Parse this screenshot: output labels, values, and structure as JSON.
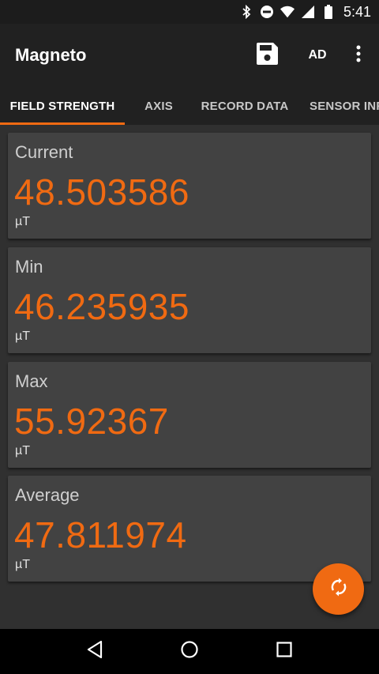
{
  "status_bar": {
    "time": "5:41",
    "icons": [
      "bluetooth-icon",
      "do-not-disturb-icon",
      "wifi-icon",
      "cell-signal-icon",
      "battery-icon"
    ]
  },
  "app_bar": {
    "title": "Magneto",
    "ad_label": "AD",
    "save_icon": "save-icon",
    "more_icon": "more-vert-icon"
  },
  "tabs": [
    {
      "label": "FIELD STRENGTH",
      "active": true
    },
    {
      "label": "AXIS",
      "active": false
    },
    {
      "label": "RECORD DATA",
      "active": false
    },
    {
      "label": "SENSOR INFO",
      "active": false
    }
  ],
  "cards": [
    {
      "label": "Current",
      "value": "48.503586",
      "unit": "µT"
    },
    {
      "label": "Min",
      "value": "46.235935",
      "unit": "µT"
    },
    {
      "label": "Max",
      "value": "55.92367",
      "unit": "µT"
    },
    {
      "label": "Average",
      "value": "47.811974",
      "unit": "µT"
    }
  ],
  "fab": {
    "icon": "refresh-icon"
  },
  "nav_bar": {
    "icons": [
      "back-icon",
      "home-icon",
      "recents-icon"
    ]
  },
  "colors": {
    "accent": "#f06a12",
    "app_bar": "#212121",
    "background": "#303030",
    "card": "#424242"
  }
}
